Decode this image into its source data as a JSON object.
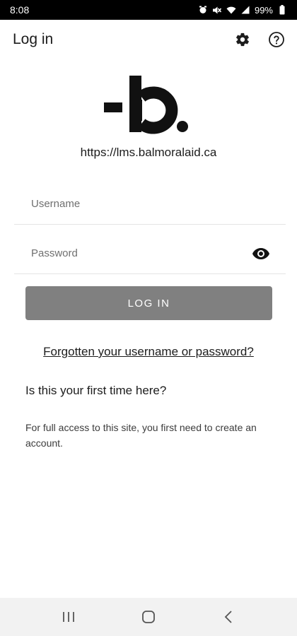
{
  "status_bar": {
    "time": "8:08",
    "battery": "99%",
    "icons": [
      "alarm-icon",
      "mute-icon",
      "wifi-icon",
      "signal-icon",
      "battery-icon"
    ]
  },
  "app_bar": {
    "title": "Log in",
    "icons": [
      "gear-icon",
      "help-icon"
    ]
  },
  "logo": {
    "text": "-b.",
    "color": "#111111"
  },
  "site": {
    "url": "https://lms.balmoralaid.ca"
  },
  "form": {
    "username_placeholder": "Username",
    "password_placeholder": "Password",
    "login_label": "LOG IN",
    "login_button_color": "#808080",
    "forgot_label": "Forgotten your username or password?"
  },
  "signup": {
    "heading": "Is this your first time here?",
    "text": "For full access to this site, you first need to create an account."
  },
  "nav_bar": {
    "icons": [
      "recents-icon",
      "home-icon",
      "back-icon"
    ]
  }
}
